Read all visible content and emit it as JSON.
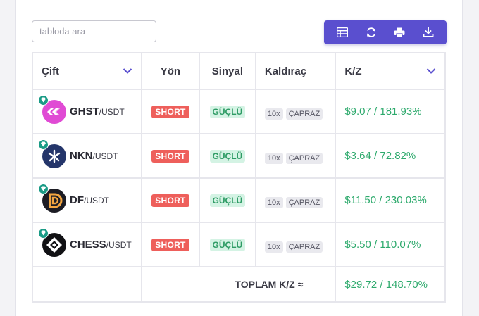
{
  "search": {
    "placeholder": "tabloda ara"
  },
  "toolbar": {
    "buttons": [
      "table-icon",
      "refresh-icon",
      "print-icon",
      "download-icon"
    ]
  },
  "table": {
    "headers": {
      "pair": "Çift",
      "direction": "Yön",
      "signal": "Sinyal",
      "leverage": "Kaldıraç",
      "pnl": "K/Z"
    },
    "rows": [
      {
        "symbol": "GHST",
        "quote": "/USDT",
        "direction": "SHORT",
        "signal": "GÜÇLÜ",
        "leverage": "10x",
        "margin": "ÇAPRAZ",
        "pnl": "$9.07 / 181.93%",
        "coin_color": "#e04ad4"
      },
      {
        "symbol": "NKN",
        "quote": "/USDT",
        "direction": "SHORT",
        "signal": "GÜÇLÜ",
        "leverage": "10x",
        "margin": "ÇAPRAZ",
        "pnl": "$3.64 / 72.82%",
        "coin_color": "#24356a"
      },
      {
        "symbol": "DF",
        "quote": "/USDT",
        "direction": "SHORT",
        "signal": "GÜÇLÜ",
        "leverage": "10x",
        "margin": "ÇAPRAZ",
        "pnl": "$11.50 / 230.03%",
        "coin_color": "#1c1c24"
      },
      {
        "symbol": "CHESS",
        "quote": "/USDT",
        "direction": "SHORT",
        "signal": "GÜÇLÜ",
        "leverage": "10x",
        "margin": "ÇAPRAZ",
        "pnl": "$5.50 / 110.07%",
        "coin_color": "#111114"
      }
    ],
    "footer": {
      "label": "TOPLAM K/Z ≈",
      "value": "$29.72 / 148.70%"
    }
  },
  "colors": {
    "accent": "#5a4fcf",
    "short": "#ee5f5b",
    "profit": "#2eaa6d",
    "badge_gem": "#1a9b86"
  }
}
